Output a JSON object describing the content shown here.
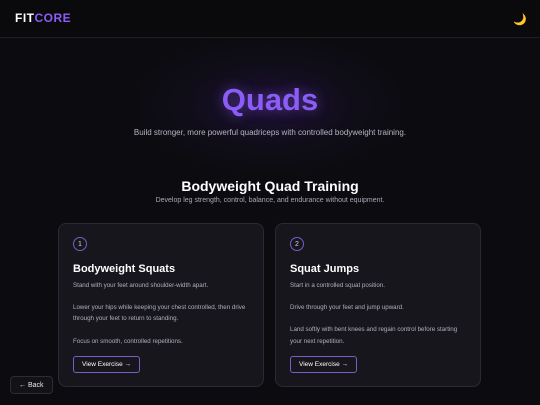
{
  "header": {
    "brand_part1": "FIT",
    "brand_part2": "CORE",
    "theme_toggle_icon": "🌙"
  },
  "hero": {
    "title": "Quads",
    "subtitle": "Build stronger, more powerful quadriceps with controlled bodyweight training."
  },
  "section": {
    "title": "Bodyweight Quad Training",
    "subtitle": "Develop leg strength, control, balance, and endurance without equipment."
  },
  "exercises": [
    {
      "number": "1",
      "title": "Bodyweight Squats",
      "paragraphs": [
        "Stand with your feet around shoulder-width apart.",
        "Lower your hips while keeping your chest controlled, then drive through your feet to return to standing.",
        "Focus on smooth, controlled repetitions."
      ],
      "button_label": "View Exercise →"
    },
    {
      "number": "2",
      "title": "Squat Jumps",
      "paragraphs": [
        "Start in a controlled squat position.",
        "Drive through your feet and jump upward.",
        "Land softly with bent knees and regain control before starting your next repetition."
      ],
      "button_label": "View Exercise →"
    }
  ],
  "back_button": "← Back",
  "colors": {
    "accent": "#8b5cf6",
    "background": "#0c0c10",
    "card": "#16161c"
  }
}
